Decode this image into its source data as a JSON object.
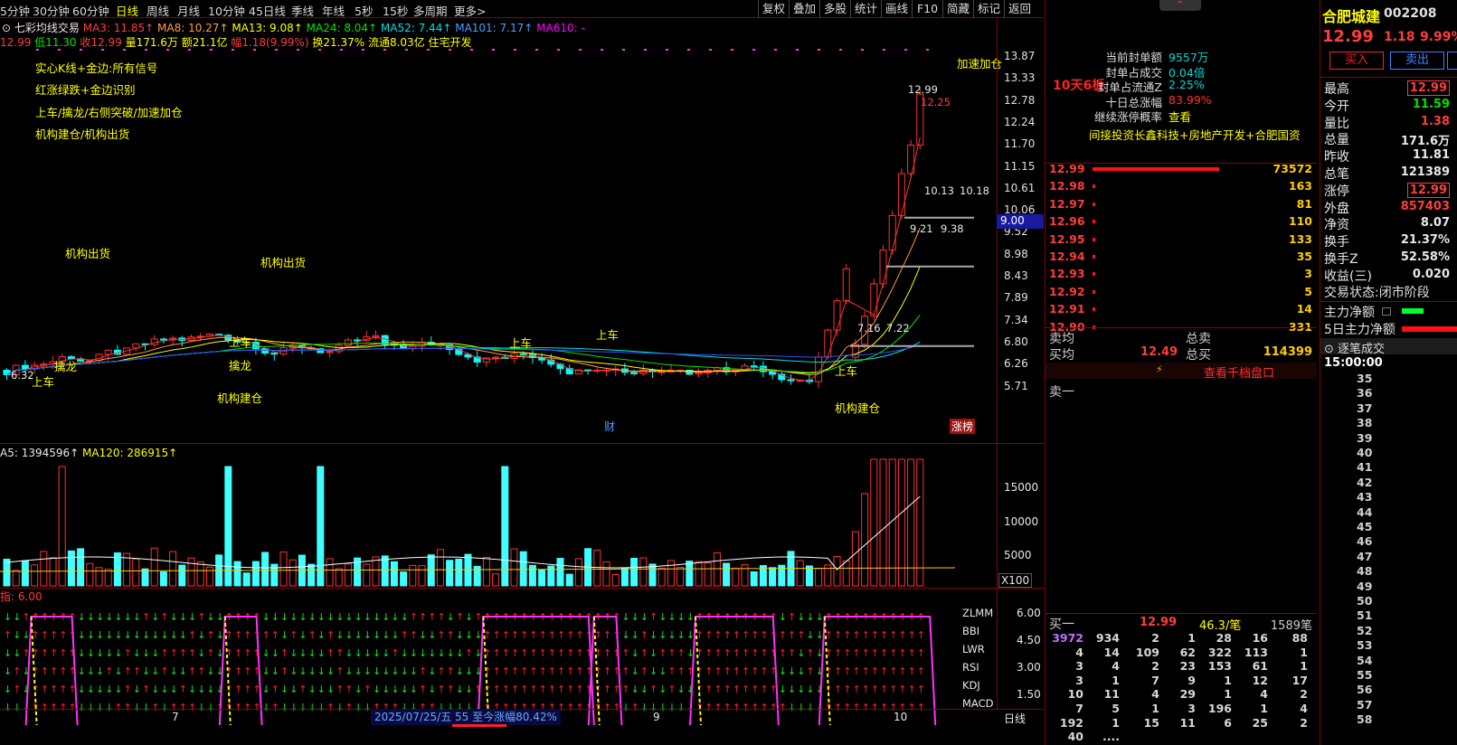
{
  "toolbar": {
    "periods": [
      "5分钟",
      "30分钟",
      "60分钟",
      "日线",
      "周线",
      "月线",
      "10分钟",
      "45日线",
      "季线",
      "年线",
      "5秒",
      "15秒",
      "多周期",
      "更多>"
    ],
    "buttons": [
      "复权",
      "叠加",
      "多股",
      "统计",
      "画线",
      "F10",
      "简藏",
      "标记",
      "返回"
    ]
  },
  "indicator_line": {
    "title": "七彩均线交易",
    "ma3": "MA3: 11.85↑",
    "ma8": "MA8: 10.27↑",
    "ma13": "MA13: 9.08↑",
    "ma24": "MA24: 8.04↑",
    "ma52": "MA52: 7.44↑",
    "ma101": "MA101: 7.17↑",
    "ma610": "MA610: -"
  },
  "quote_line": {
    "open": "12.99",
    "low": "低11.30",
    "close": "收12.99",
    "vol": "量171.6万",
    "amount": "额21.1亿",
    "change": "幅1.18(9.99%)",
    "turnover": "换21.37%",
    "float": "流通8.03亿",
    "sector": "住宅开发"
  },
  "legend": [
    "实心K线+金边:所有信号",
    "红涨绿跌+金边识别",
    "上车/擒龙/右侧突破/加速加仓",
    "机构建仓/机构出货"
  ],
  "annotations": {
    "jgch": "机构出货",
    "jgjc": "机构建仓",
    "shangche": "上车",
    "qinlong": "擒龙",
    "jiasu": "加速加仓",
    "cai": "财",
    "zhangbang": "涨榜"
  },
  "price_labels": {
    "hi": "12.99",
    "p1225": "12.25",
    "p1013": "10.13",
    "p1018": "10.18",
    "p921": "9.21",
    "p938": "9.38",
    "p716": "7.16",
    "p722": "7.22",
    "p632": "6.32",
    "cursor": "9.00"
  },
  "y_axis": [
    "13.87",
    "13.33",
    "12.78",
    "12.24",
    "11.70",
    "11.15",
    "10.61",
    "10.06",
    "9.52",
    "8.98",
    "8.43",
    "7.89",
    "7.34",
    "6.80",
    "6.26",
    "5.71"
  ],
  "vol_panel": {
    "label": "A5: 1394596↑",
    "ma120": "MA120: 286915↑",
    "y": [
      "15000",
      "10000",
      "5000"
    ],
    "unit": "X100"
  },
  "signal_panel": {
    "label": "指: 6.00",
    "rows": [
      "ZLMM",
      "BBI",
      "LWR",
      "RSI",
      "KDJ",
      "MACD"
    ],
    "y": [
      "6.00",
      "4.50",
      "3.00",
      "1.50"
    ]
  },
  "bottom_bar": {
    "date_info": "2025/07/25/五  55 至今涨幅80.42%",
    "months": [
      "7",
      "9",
      "10"
    ],
    "period": "日线"
  },
  "seal_info": {
    "title": "10天6板",
    "items": [
      [
        "当前封单额",
        "9557万"
      ],
      [
        "封单占成交",
        "0.04倍"
      ],
      [
        "封单占流通Z",
        "2.25%"
      ],
      [
        "十日总涨幅",
        "83.99%"
      ],
      [
        "继续涨停概率",
        "查看"
      ]
    ],
    "concept": "间接投资长鑫科技+房地产开发+合肥国资"
  },
  "levels": [
    [
      "12.99",
      "73572"
    ],
    [
      "12.98",
      "163"
    ],
    [
      "12.97",
      "81"
    ],
    [
      "12.96",
      "110"
    ],
    [
      "12.95",
      "133"
    ],
    [
      "12.94",
      "35"
    ],
    [
      "12.93",
      "3"
    ],
    [
      "12.92",
      "5"
    ],
    [
      "12.91",
      "14"
    ],
    [
      "12.90",
      "331"
    ]
  ],
  "avg": {
    "sell_avg": "卖均",
    "buy_avg": "买均",
    "buy_avg_v": "12.49",
    "total_sell": "总卖",
    "total_buy": "总买",
    "total_buy_v": "114399"
  },
  "view_depth": "查看千档盘口",
  "sell1": "卖一",
  "buy1": {
    "label": "买一",
    "price": "12.99",
    "per": "46.3/笔",
    "count": "1589笔"
  },
  "queue": [
    [
      "3972",
      "934",
      "2",
      "1",
      "28",
      "16",
      "88"
    ],
    [
      "4",
      "14",
      "109",
      "62",
      "322",
      "113",
      "1"
    ],
    [
      "3",
      "4",
      "2",
      "23",
      "153",
      "61",
      "1"
    ],
    [
      "3",
      "1",
      "7",
      "9",
      "1",
      "12",
      "17"
    ],
    [
      "10",
      "11",
      "4",
      "29",
      "1",
      "4",
      "2"
    ],
    [
      "7",
      "5",
      "1",
      "3",
      "196",
      "1",
      "4"
    ],
    [
      "192",
      "1",
      "15",
      "11",
      "6",
      "25",
      "2"
    ],
    [
      "40",
      "....",
      "",
      "",
      "",
      "",
      ""
    ]
  ],
  "stock": {
    "name": "合肥城建",
    "code": "002208",
    "price": "12.99",
    "change": "1.18",
    "pct": "9.99%",
    "buy": "买入",
    "sell": "卖出"
  },
  "stats": [
    [
      "最高",
      "12.99"
    ],
    [
      "今开",
      "11.59"
    ],
    [
      "量比",
      "1.38"
    ],
    [
      "总量",
      "171.6万"
    ],
    [
      "昨收",
      "11.81"
    ],
    [
      "总笔",
      "121389"
    ],
    [
      "涨停",
      "12.99"
    ],
    [
      "外盘",
      "857403"
    ],
    [
      "净资",
      "8.07"
    ],
    [
      "换手",
      "21.37%"
    ],
    [
      "换手Z",
      "52.58%"
    ],
    [
      "收益(三)",
      "0.020"
    ]
  ],
  "status": {
    "label": "交易状态:",
    "value": "闭市阶段"
  },
  "flows": [
    "主力净额",
    "5日主力净额"
  ],
  "ticks_header": "逐笔成交",
  "ticks_time": "15:00:00",
  "ticks": [
    "35",
    "36",
    "37",
    "38",
    "39",
    "40",
    "41",
    "42",
    "43",
    "44",
    "45",
    "46",
    "47",
    "48",
    "49",
    "50",
    "51",
    "52",
    "53",
    "54",
    "55",
    "56",
    "57",
    "58"
  ]
}
